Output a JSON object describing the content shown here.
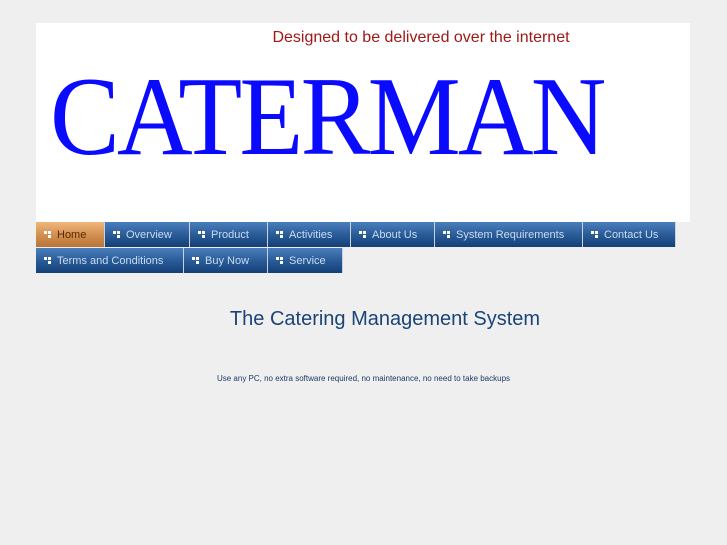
{
  "header": {
    "tagline": "Designed to be delivered over the internet",
    "logo_text": "CATERMAN"
  },
  "nav": {
    "row1": [
      {
        "label": "Home",
        "active": true,
        "icon": "bullet-squares-icon"
      },
      {
        "label": "Overview",
        "active": false,
        "icon": "bullet-squares-icon"
      },
      {
        "label": "Product",
        "active": false,
        "icon": "bullet-squares-icon"
      },
      {
        "label": "Activities",
        "active": false,
        "icon": "bullet-squares-icon"
      },
      {
        "label": "About Us",
        "active": false,
        "icon": "bullet-squares-icon"
      },
      {
        "label": "System Requirements",
        "active": false,
        "icon": "bullet-squares-icon"
      },
      {
        "label": "Contact Us",
        "active": false,
        "icon": "bullet-squares-icon"
      }
    ],
    "row2": [
      {
        "label": "Terms and Conditions",
        "active": false,
        "icon": "bullet-squares-icon"
      },
      {
        "label": "Buy Now",
        "active": false,
        "icon": "bullet-squares-icon"
      },
      {
        "label": "Service",
        "active": false,
        "icon": "bullet-squares-icon"
      }
    ]
  },
  "main": {
    "title": "The Catering Management System",
    "subtitle": "Use any PC, no extra software required, no maintenance, no need to take backups"
  },
  "colors": {
    "page_bg": "#efefef",
    "tagline": "#a01818",
    "logo": "#0a0aff",
    "nav_blue": "#2a5c98",
    "nav_active": "#d08d4f",
    "title": "#1a4477"
  }
}
